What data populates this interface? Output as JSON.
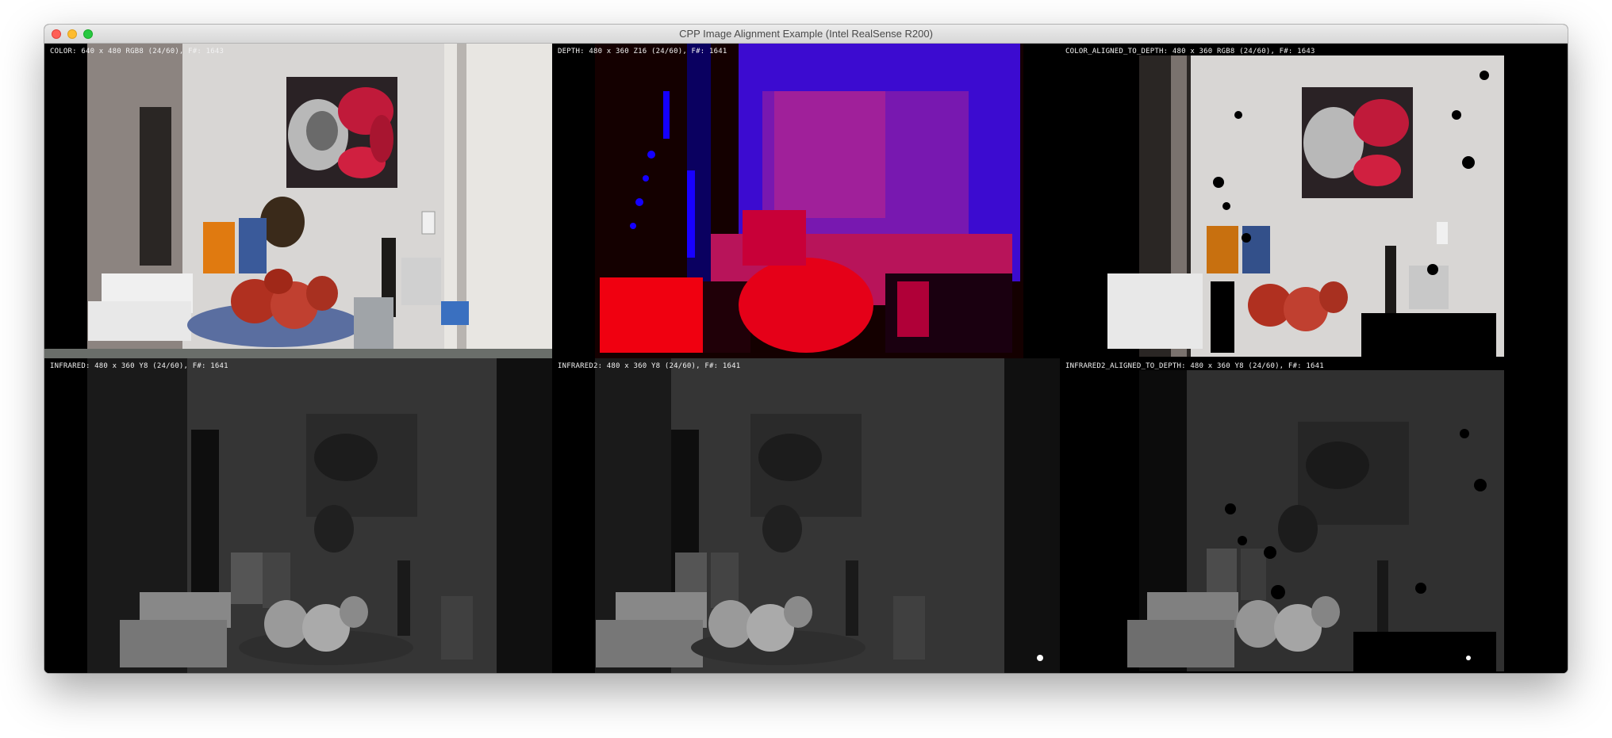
{
  "window": {
    "title": "CPP Image Alignment Example (Intel RealSense R200)",
    "controls": [
      {
        "name": "close",
        "color": "#fe5f57"
      },
      {
        "name": "minimize",
        "color": "#febc2e"
      },
      {
        "name": "maximize",
        "color": "#28c840"
      }
    ]
  },
  "streams": [
    {
      "label": "COLOR: 640 x 480 RGB8 (24/60), F#: 1643"
    },
    {
      "label": "DEPTH: 480 x 360 Z16 (24/60), F#: 1641"
    },
    {
      "label": "COLOR_ALIGNED_TO_DEPTH: 480 x 360 RGB8 (24/60), F#: 1643"
    },
    {
      "label": "INFRARED: 480 x 360 Y8 (24/60), F#: 1641"
    },
    {
      "label": "INFRARED2: 480 x 360 Y8 (24/60), F#: 1641"
    },
    {
      "label": "INFRARED2_ALIGNED_TO_DEPTH: 480 x 360 Y8 (24/60), F#: 1641"
    }
  ],
  "depth_colormap": {
    "near": "#ff0000",
    "far": "#0000ff",
    "invalid": "#000000"
  }
}
